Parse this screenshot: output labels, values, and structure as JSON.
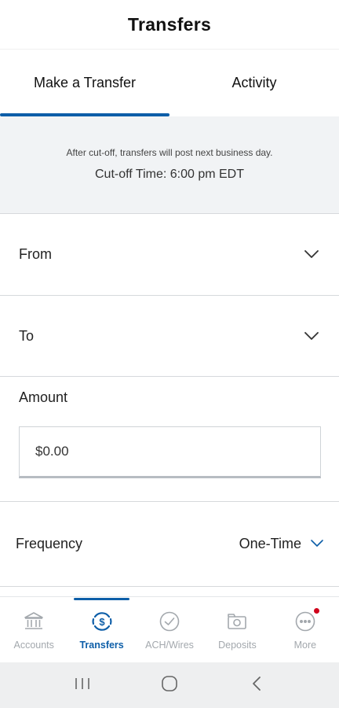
{
  "header": {
    "title": "Transfers"
  },
  "tabs": [
    {
      "label": "Make a Transfer",
      "active": true
    },
    {
      "label": "Activity",
      "active": false
    }
  ],
  "cutoff": {
    "note": "After cut-off, transfers will post next business day.",
    "time": "Cut-off Time: 6:00 pm EDT"
  },
  "form": {
    "from_label": "From",
    "to_label": "To",
    "amount_label": "Amount",
    "amount_value": "$0.00",
    "frequency_label": "Frequency",
    "frequency_value": "One-Time"
  },
  "bottom_nav": {
    "items": [
      {
        "label": "Accounts",
        "icon": "bank-icon",
        "active": false
      },
      {
        "label": "Transfers",
        "icon": "transfer-dollar-icon",
        "active": true
      },
      {
        "label": "ACH/Wires",
        "icon": "check-circle-icon",
        "active": false
      },
      {
        "label": "Deposits",
        "icon": "camera-icon",
        "active": false
      },
      {
        "label": "More",
        "icon": "more-icon",
        "active": false,
        "notification_dot": true
      }
    ]
  },
  "system_nav": {
    "buttons": [
      "recents-icon",
      "home-icon",
      "back-icon"
    ]
  },
  "colors": {
    "accent": "#0d5ea8",
    "inactive": "#a3a8ad",
    "banner_bg": "#f1f3f5",
    "notification": "#d0021b"
  }
}
